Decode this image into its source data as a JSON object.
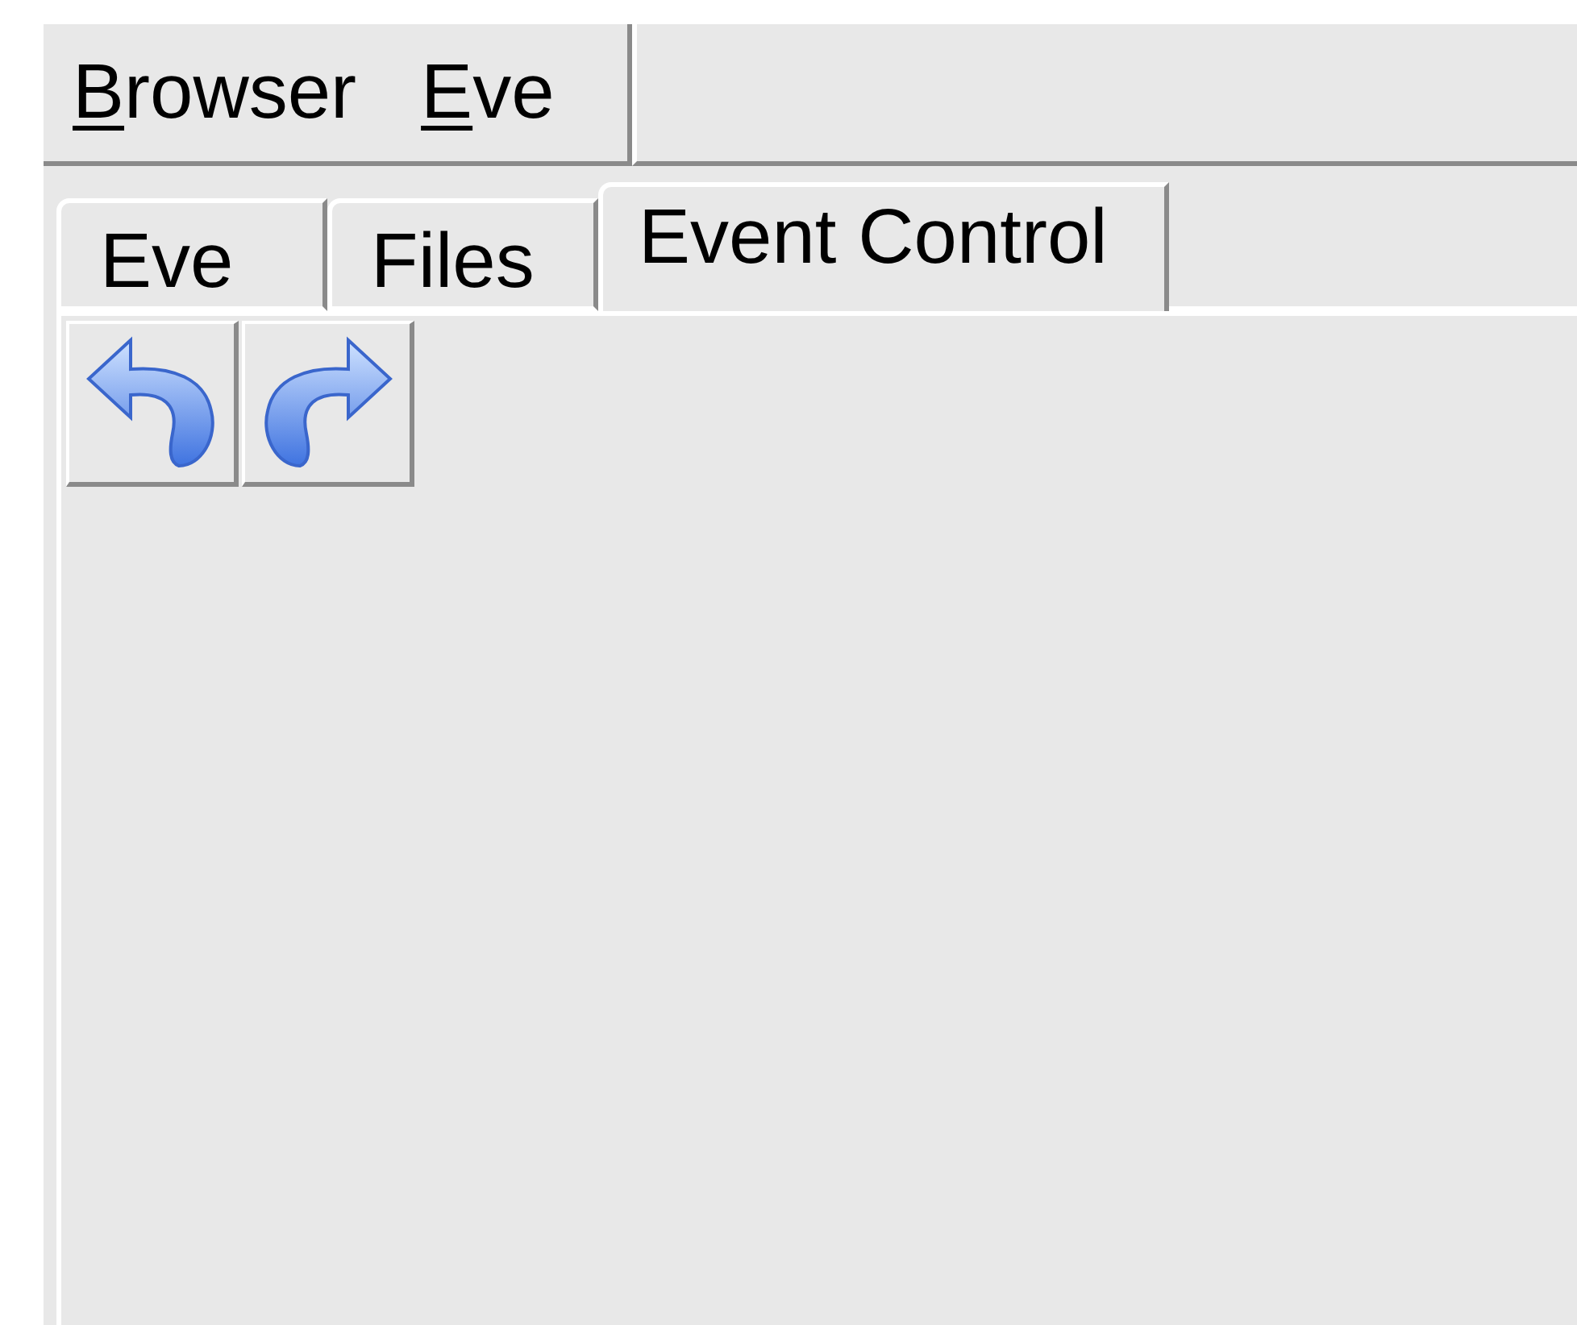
{
  "menu_bar": {
    "items": [
      {
        "accel": "B",
        "rest": "rowser"
      },
      {
        "accel": "E",
        "rest": "ve"
      }
    ]
  },
  "tabs": [
    {
      "label": "Eve",
      "selected": false
    },
    {
      "label": "Files",
      "selected": false
    },
    {
      "label": "Event Control",
      "selected": true
    }
  ],
  "toolbar": {
    "buttons": [
      {
        "kind": "back"
      },
      {
        "kind": "forward"
      }
    ]
  }
}
